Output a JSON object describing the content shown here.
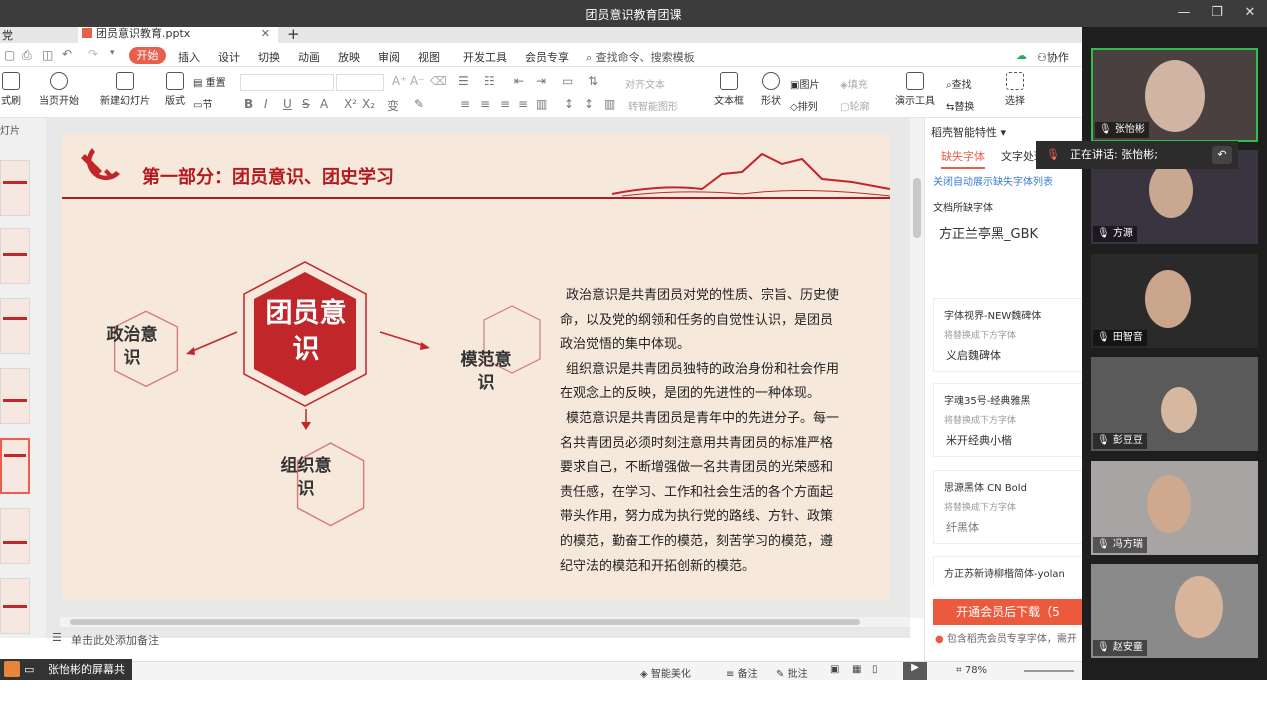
{
  "window": {
    "title": "团员意识教育团课"
  },
  "wps": {
    "tab_left": "党",
    "doc_tab": "团员意识教育.pptx",
    "menu": {
      "start": "开始",
      "insert": "插入",
      "design": "设计",
      "transition": "切换",
      "animation": "动画",
      "slideshow": "放映",
      "review": "审阅",
      "view": "视图",
      "dev": "开发工具",
      "member": "会员专享",
      "search": "查找命令、搜索模板",
      "collab": "协作"
    },
    "toolbar": {
      "format_painter": "式刷",
      "from_current": "当页开始",
      "new_slide": "新建幻灯片",
      "layout": "版式",
      "reset": "重置",
      "section": "节",
      "text_direction": "对齐文本",
      "convert": "转智能图形",
      "textbox": "文本框",
      "shape": "形状",
      "picture": "图片",
      "fill": "填充",
      "arrange": "排列",
      "outline": "轮廓",
      "presenter": "演示工具",
      "find": "查找",
      "replace": "替换",
      "select": "选择"
    },
    "thumb_label": "灯片",
    "slide": {
      "heading": "第一部分：团员意识、团史学习",
      "center": "团员意识",
      "node_political": "政治意识",
      "node_model": "模范意识",
      "node_org": "组织意识",
      "lines": [
        "政治意识是共青团员对党的性质、宗旨、历史使",
        "命，以及党的纲领和任务的自觉性认识，是团员",
        "政治觉悟的集中体现。",
        "组织意识是共青团员独特的政治身份和社会作用",
        "在观念上的反映，是团的先进性的一种体现。",
        "模范意识是共青团员是青年中的先进分子。每一",
        "名共青团员必须时刻注意用共青团员的标准严格",
        "要求自己，不断增强做一名共青团员的光荣感和",
        "责任感，在学习、工作和社会生活的各个方面起",
        "带头作用，努力成为执行党的路线、方针、政策",
        "的模范，勤奋工作的模范，刻苦学习的模范，遵",
        "纪守法的模范和开拓创新的模范。"
      ]
    },
    "notes": "单击此处添加备注",
    "status": {
      "beautify": "智能美化",
      "notes": "备注",
      "comment": "批注",
      "zoom": "78%"
    },
    "panel": {
      "title": "稻壳智能特性",
      "tab_missing": "缺失字体",
      "tab_text": "文字处理",
      "hide_link": "关闭自动展示缺失字体列表",
      "missing_label": "文档所缺字体",
      "font_main": "方正兰亭黑_GBK",
      "fonts": [
        {
          "name": "字体视界-NEW魏碑体",
          "replace": "将替换成下方字体",
          "sample": "义启魏碑体"
        },
        {
          "name": "字魂35号-经典雅黑",
          "replace": "将替换成下方字体",
          "sample": "米开经典小楷"
        },
        {
          "name": "思源黑体 CN Bold",
          "replace": "将替换成下方字体",
          "sample": "纤黑体"
        },
        {
          "name": "方正苏新诗柳楷简体-yolan",
          "replace": "",
          "sample": ""
        }
      ],
      "download": "开通会员后下载（5",
      "promo": "包含稻壳会员专享字体，需开"
    }
  },
  "meeting": {
    "speaking": "正在讲话: 张怡彬;",
    "share": "张怡彬的屏幕共享",
    "participants": [
      "张怡彬",
      "方源",
      "田智音",
      "彭豆豆",
      "冯方瑞",
      "赵安童"
    ]
  }
}
